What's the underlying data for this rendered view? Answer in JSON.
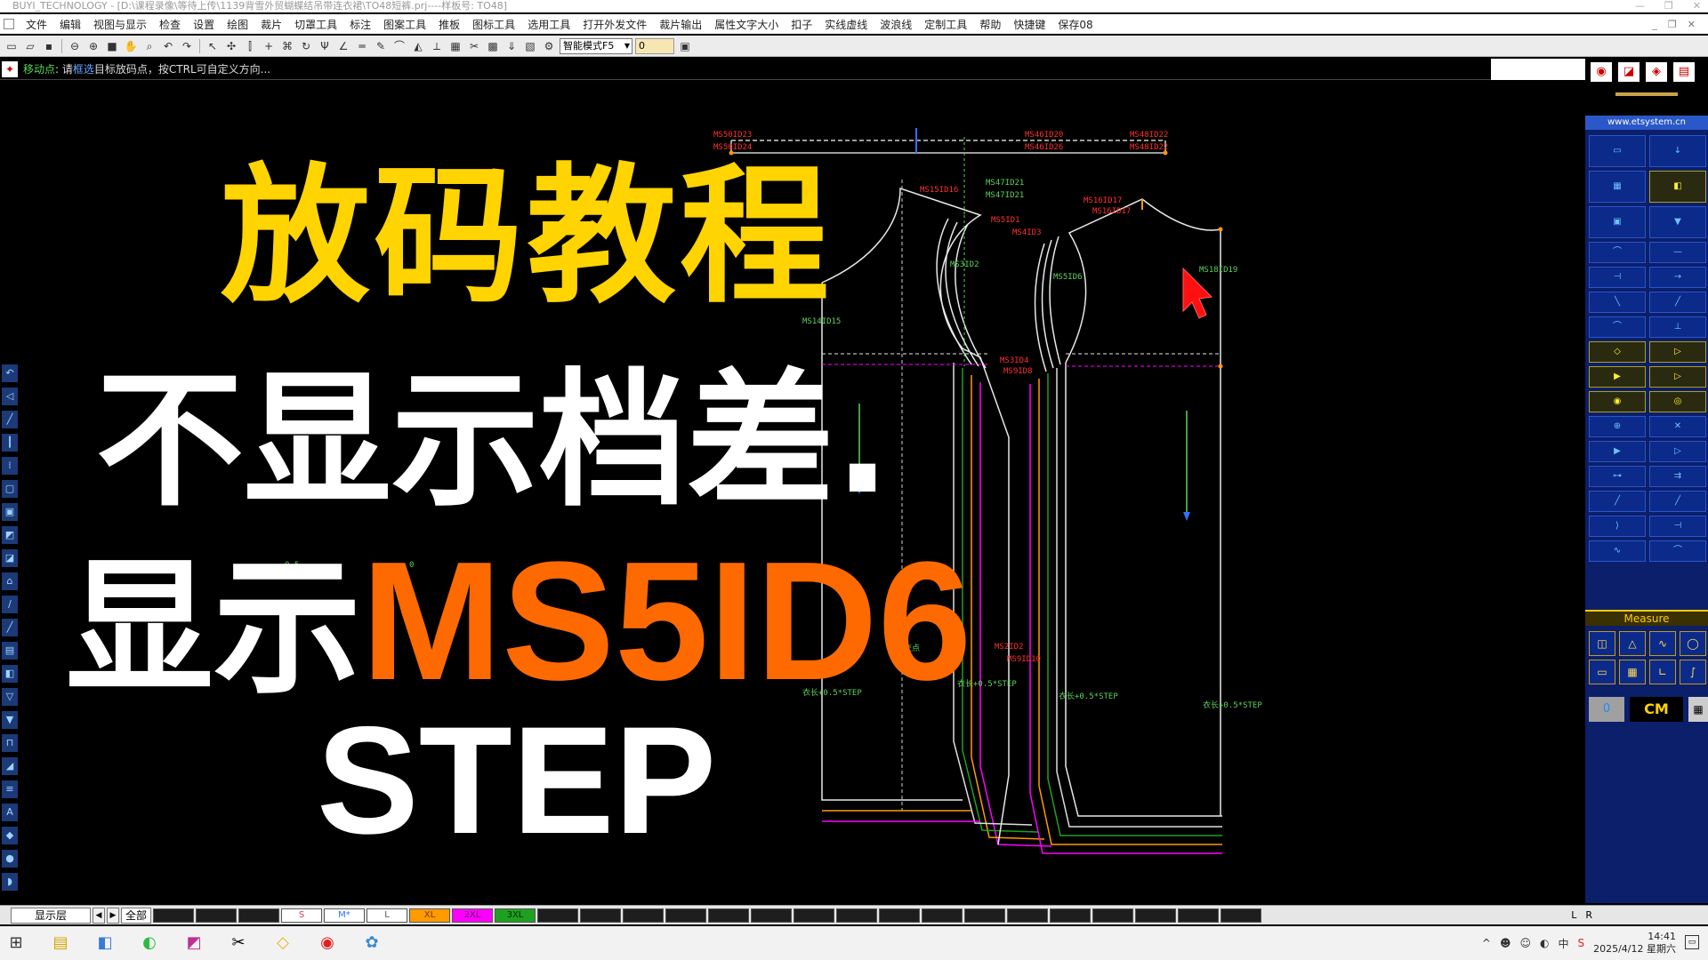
{
  "window": {
    "title": "BUYI_TECHNOLOGY - [D:\\课程录像\\等待上传\\1139背雪外贸蝴蝶结吊带连衣裙\\TO48短裤.prj----样板号: TO48]",
    "controls": [
      "—",
      "❐",
      "✕"
    ]
  },
  "menu": {
    "items": [
      "文件",
      "编辑",
      "视图与显示",
      "检查",
      "设置",
      "绘图",
      "裁片",
      "切罩工具",
      "标注",
      "图案工具",
      "推板",
      "图标工具",
      "选用工具",
      "打开外发文件",
      "裁片输出",
      "属性文字大小",
      "扣子",
      "实线虚线",
      "波浪线",
      "定制工具",
      "帮助",
      "快捷键",
      "保存08"
    ],
    "mdi_controls": [
      "_",
      "❐",
      "✕"
    ]
  },
  "toolbar": {
    "mode_select": "智能模式F5",
    "value_field": "0"
  },
  "prompt": {
    "mode": "移动点",
    "pre": ": 请",
    "highlight": "框选",
    "post": "目标放码点，按CTRL可自定义方向..."
  },
  "overlay": {
    "line1": "放码教程",
    "line2": "不显示档差.",
    "line3_prefix": "显示",
    "line3_code": "MS5ID6",
    "line4": "STEP"
  },
  "canvas_labels": {
    "top_left_a": "MS50ID23",
    "top_left_b": "MS50ID24",
    "top_mid_a": "MS46ID20",
    "top_mid_b": "MS46ID26",
    "top_right_a": "MS48ID22",
    "top_right_b": "MS48ID22",
    "mid_a": "MS47ID21",
    "mid_b": "MS47ID21",
    "shoulder_l": "MS15ID16",
    "shoulder_c": "MS5ID1",
    "shoulder_r": "MS16ID17",
    "shoulder_r2": "MS16ID17",
    "neck_c": "MS4ID3",
    "neck_l": "MS3ID2",
    "neck_r": "MS5ID6",
    "right_side": "MS18ID19",
    "left_side": "MS14ID15",
    "waist_a": "MS3ID4",
    "waist_b": "MS9ID8",
    "hem_c": "MS2ID2",
    "hem_c2": "MS9ID10",
    "hem_note": "下前交点",
    "step_1": "衣长+0.5*STEP",
    "step_2": "衣长+0.5*STEP",
    "step_3": "衣长+0.5*STEP",
    "step_4": "衣长+0.5*STEP",
    "small_a": "0.5",
    "small_b": "0"
  },
  "left_tools": [
    "↶",
    "◁",
    "╱",
    "┃",
    "⁞",
    "▢",
    "▣",
    "◩",
    "◪",
    "⌂",
    "∕",
    "╱",
    "▤",
    "◧",
    "▽",
    "▼",
    "⊓",
    "◢",
    "≡",
    "A",
    "◆",
    "●",
    "◗"
  ],
  "right_panel": {
    "url": "www.etsystem.cn",
    "measure_label": "Measure",
    "zero": "0",
    "unit": "CM",
    "top_icons": [
      "◉",
      "◪",
      "◈",
      "▤"
    ]
  },
  "layer_bar": {
    "label": "显示层",
    "all": "全部",
    "sizes": [
      {
        "name": "S",
        "color": "#e04040"
      },
      {
        "name": "M*",
        "color": "#3070ff"
      },
      {
        "name": "L",
        "color": "#555555"
      },
      {
        "name": "XL",
        "color": "#ff9a00"
      },
      {
        "name": "2XL",
        "color": "#ff00ff"
      },
      {
        "name": "3XL",
        "color": "#20a020"
      }
    ],
    "lr": [
      "L",
      "R"
    ]
  },
  "taskbar": {
    "time": "14:41",
    "date": "2025/4/12 星期六",
    "apps": [
      "⊞",
      "▤",
      "◧",
      "◐",
      "◩",
      "✂",
      "◇",
      "◉",
      "✿"
    ],
    "tray": [
      "^",
      "☻",
      "☺",
      "◐",
      "中",
      "S"
    ]
  },
  "colors": {
    "overlay_yellow": "#ffd400",
    "overlay_orange": "#ff6a00",
    "pattern_line": "#e8e8e8",
    "label_red": "#ff3030",
    "label_green": "#5cd35c",
    "panel_blue": "#0b1f6a"
  }
}
